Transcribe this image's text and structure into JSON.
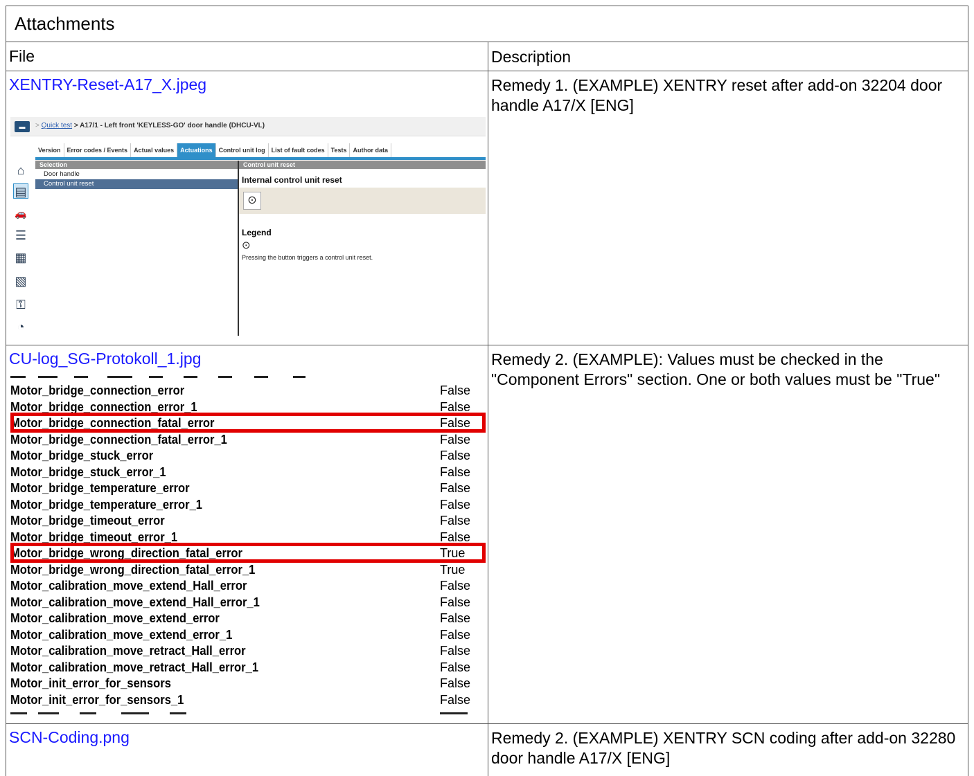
{
  "title": "Attachments",
  "headers": {
    "file": "File",
    "description": "Description"
  },
  "rows": [
    {
      "file": "XENTRY-Reset-A17_X.jpeg",
      "description": "Remedy 1. (EXAMPLE) XENTRY reset after add-on 32204 door handle A17/X [ENG]"
    },
    {
      "file": "CU-log_SG-Protokoll_1.jpg",
      "description": "Remedy 2. (EXAMPLE): Values must be checked in the \"Component Errors\" section. One or both values must be \"True\""
    },
    {
      "file": "SCN-Coding.png",
      "description": "Remedy 2. (EXAMPLE) XENTRY SCN coding after add-on 32280 door handle A17/X [ENG]"
    }
  ],
  "xentry": {
    "breadcrumb_sep": ">",
    "breadcrumb_link": "Quick test",
    "breadcrumb_rest": "> A17/1 - Left front 'KEYLESS-GO' door handle (DHCU-VL)",
    "tabs": [
      "Version",
      "Error codes / Events",
      "Actual values",
      "Actuations",
      "Control unit log",
      "List of fault codes",
      "Tests",
      "Author data"
    ],
    "active_tab": "Actuations",
    "selection_header": "Selection",
    "selection_items": [
      "Door handle",
      "Control unit reset"
    ],
    "selected_item": "Control unit reset",
    "panel_header": "Control unit reset",
    "panel_title": "Internal control unit reset",
    "legend_title": "Legend",
    "legend_text": "Pressing the button triggers a control unit reset.",
    "reset_icon": "⊙",
    "side_icons": [
      "home-icon",
      "vehicle-info-icon",
      "car-alert-icon",
      "list-icon",
      "grid-icon",
      "document-icon",
      "secure-icon",
      "speedometer-icon"
    ]
  },
  "cu_log": {
    "entries": [
      {
        "name": "Motor_bridge_connection_error",
        "value": "False"
      },
      {
        "name": "Motor_bridge_connection_error_1",
        "value": "False"
      },
      {
        "name": "Motor_bridge_connection_fatal_error",
        "value": "False",
        "highlighted": true
      },
      {
        "name": "Motor_bridge_connection_fatal_error_1",
        "value": "False"
      },
      {
        "name": "Motor_bridge_stuck_error",
        "value": "False"
      },
      {
        "name": "Motor_bridge_stuck_error_1",
        "value": "False"
      },
      {
        "name": "Motor_bridge_temperature_error",
        "value": "False"
      },
      {
        "name": "Motor_bridge_temperature_error_1",
        "value": "False"
      },
      {
        "name": "Motor_bridge_timeout_error",
        "value": "False"
      },
      {
        "name": "Motor_bridge_timeout_error_1",
        "value": "False"
      },
      {
        "name": "Motor_bridge_wrong_direction_fatal_error",
        "value": "True",
        "highlighted": true
      },
      {
        "name": "Motor_bridge_wrong_direction_fatal_error_1",
        "value": "True"
      },
      {
        "name": "Motor_calibration_move_extend_Hall_error",
        "value": "False"
      },
      {
        "name": "Motor_calibration_move_extend_Hall_error_1",
        "value": "False"
      },
      {
        "name": "Motor_calibration_move_extend_error",
        "value": "False"
      },
      {
        "name": "Motor_calibration_move_extend_error_1",
        "value": "False"
      },
      {
        "name": "Motor_calibration_move_retract_Hall_error",
        "value": "False"
      },
      {
        "name": "Motor_calibration_move_retract_Hall_error_1",
        "value": "False"
      },
      {
        "name": "Motor_init_error_for_sensors",
        "value": "False"
      },
      {
        "name": "Motor_init_error_for_sensors_1",
        "value": "False"
      }
    ],
    "highlight_color": "#e10000"
  },
  "colors": {
    "link": "#1a1aff",
    "xentry_accent": "#2f8fc9",
    "border": "#555555"
  }
}
